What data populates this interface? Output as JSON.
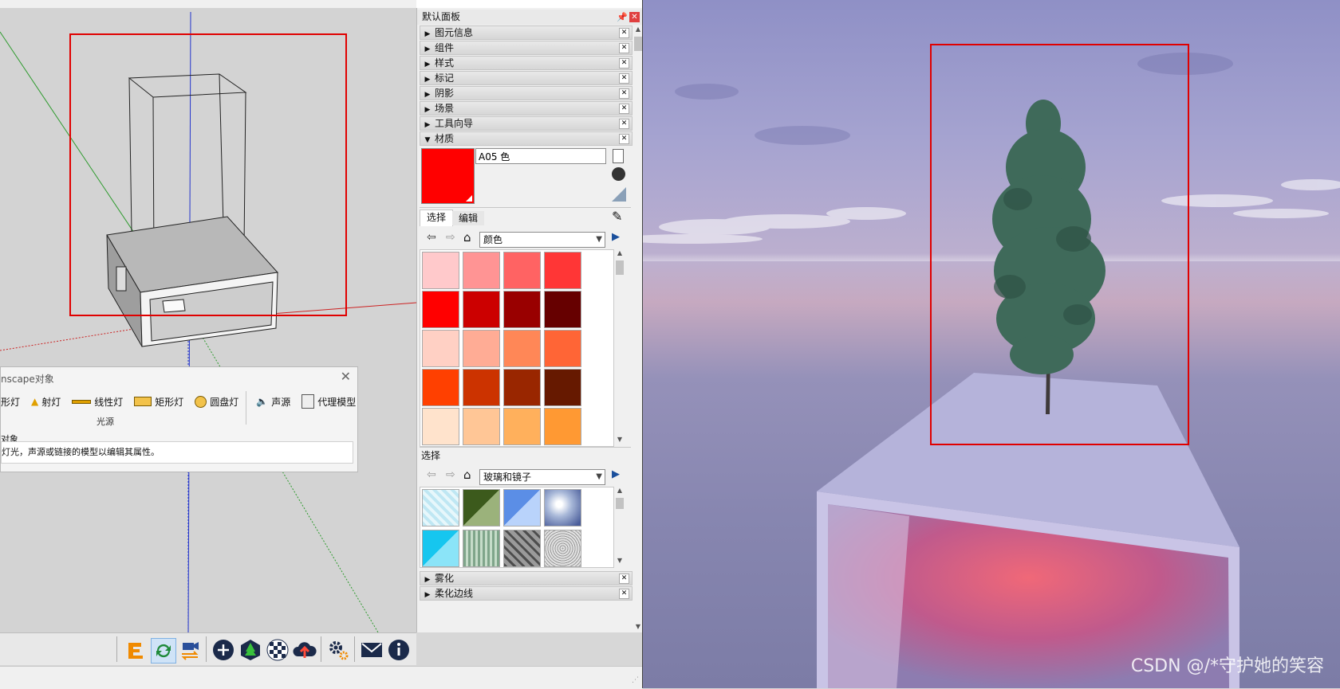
{
  "panel": {
    "title": "默认面板",
    "trays": [
      {
        "label": "图元信息",
        "expanded": false
      },
      {
        "label": "组件",
        "expanded": false
      },
      {
        "label": "样式",
        "expanded": false
      },
      {
        "label": "标记",
        "expanded": false
      },
      {
        "label": "阴影",
        "expanded": false
      },
      {
        "label": "场景",
        "expanded": false
      },
      {
        "label": "工具向导",
        "expanded": false
      },
      {
        "label": "材质",
        "expanded": true
      }
    ],
    "material": {
      "name": "A05 色",
      "current_color": "#ff0000",
      "tabs": [
        "选择",
        "编辑"
      ],
      "library": "颜色",
      "swatches": [
        "#ffc9cb",
        "#ff9494",
        "#ff6363",
        "#ff3636",
        "#ff0000",
        "#cc0000",
        "#990000",
        "#660000",
        "#ffd0c4",
        "#ffac95",
        "#ff8757",
        "#ff6536",
        "#ff4000",
        "#cc3300",
        "#992600",
        "#661900",
        "#ffe3cc",
        "#ffc696",
        "#ffb05c",
        "#ff9933"
      ],
      "secondary_label": "选择",
      "secondary_library": "玻璃和镜子",
      "secondary_swatches": [
        "glass-light-blue",
        "glass-green",
        "glass-blue",
        "sky-reflection",
        "glass-cyan",
        "glass-grooved",
        "mesh-gray",
        "stone-noise"
      ]
    },
    "bottom_trays": [
      {
        "label": "雾化"
      },
      {
        "label": "柔化边线"
      }
    ]
  },
  "dialog": {
    "title": "nscape对象",
    "tools": [
      "球形灯",
      "射灯",
      "线性灯",
      "矩形灯",
      "圆盘灯",
      "声源",
      "代理模型"
    ],
    "group_label": "光源",
    "section_title": "对象",
    "hint": "灯光，声源或链接的模型以编辑其属性。"
  },
  "toolbar": {
    "icons": [
      "enscape-start-icon",
      "sync-icon",
      "sync-views-icon",
      "add-icon",
      "tree-asset-icon",
      "material-icon",
      "upload-icon",
      "settings-icon",
      "feedback-mail-icon",
      "info-icon"
    ]
  },
  "render": {
    "watermark": "CSDN @/*守护她的笑容"
  }
}
